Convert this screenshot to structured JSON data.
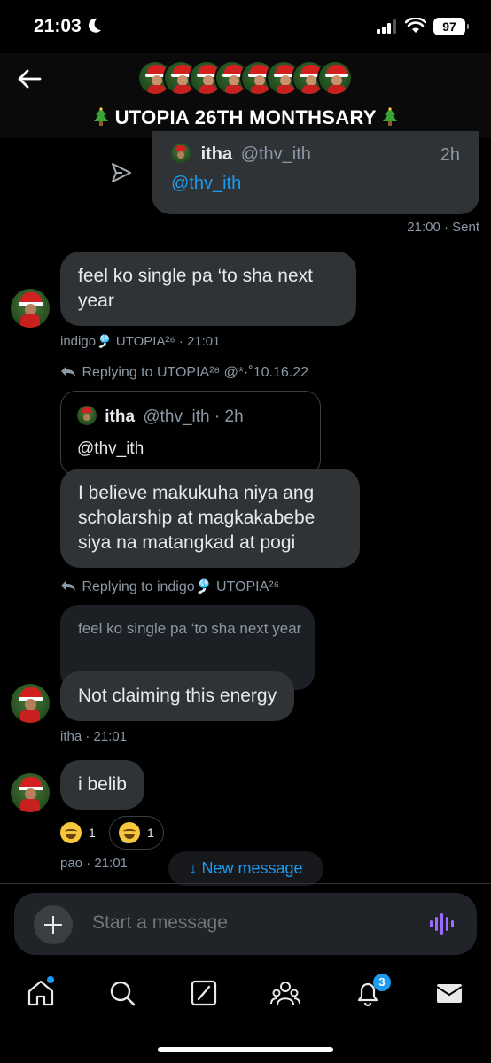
{
  "status_bar": {
    "time": "21:03",
    "battery": "97"
  },
  "header": {
    "title": "UTOPIA 26TH MONTHSARY"
  },
  "sent_quote": {
    "name": "itha",
    "handle": "@thv_ith",
    "age": "2h",
    "body": "@thv_ith",
    "meta": "21:00 · Sent"
  },
  "messages": [
    {
      "text": "feel ko single pa ‘to sha next year",
      "meta": "indigo🎐 UTOPIA²⁶ · 21:01"
    },
    {
      "reply_to": "Replying to UTOPIA²⁶ @*·˚10.16.22",
      "quote_name": "itha",
      "quote_meta": "@thv_ith · 2h",
      "quote_body": "@thv_ith",
      "text": "I believe makukuha niya ang scholarship at magkakabebe siya na matangkad at pogi"
    },
    {
      "reply_to": "Replying to indigo🎐 UTOPIA²⁶",
      "quoted_text": "feel ko single pa ‘to sha next year",
      "text": "Not claiming this energy",
      "meta": "itha · 21:01"
    },
    {
      "text": "i belib",
      "reactions": [
        {
          "emoji": "laughing-face",
          "count": "1"
        },
        {
          "emoji": "tears-of-joy-face",
          "count": "1"
        }
      ],
      "meta": "pao · 21:01"
    }
  ],
  "new_message_pill": "↓ New message",
  "composer": {
    "placeholder": "Start a message"
  },
  "tabbar": {
    "notifications_count": "3"
  },
  "colors": {
    "accent": "#1d9bf0",
    "bubble": "#2f3336",
    "background": "#000000",
    "voice": "#9d6cff"
  }
}
